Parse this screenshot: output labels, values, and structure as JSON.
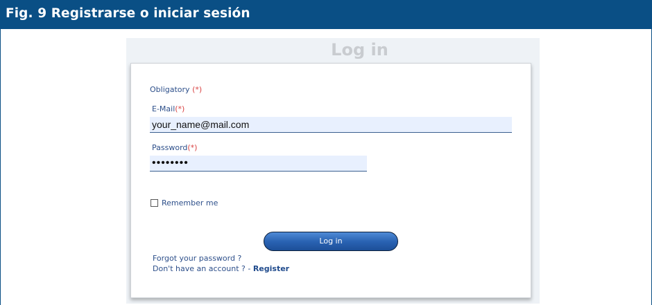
{
  "figure": {
    "title": "Fig. 9 Registrarse o iniciar sesión"
  },
  "page": {
    "title": "Log in"
  },
  "form": {
    "obligatory_label": "Obligatory",
    "required_marker": "(*)",
    "email_label": "E-Mail",
    "email_value": "your_name@mail.com",
    "password_label": "Password",
    "password_value": "••••••••",
    "remember_label": "Remember me",
    "remember_checked": false,
    "login_button": "Log in"
  },
  "links": {
    "forgot": "Forgot your password ?",
    "no_account": "Don't have an account ? - ",
    "register": "Register"
  },
  "colors": {
    "header_bg": "#0a4f85",
    "label_text": "#2d4f8a",
    "required_marker": "#d94343",
    "input_bg": "#e8f0fe",
    "button_bg": "#2a63b3"
  }
}
